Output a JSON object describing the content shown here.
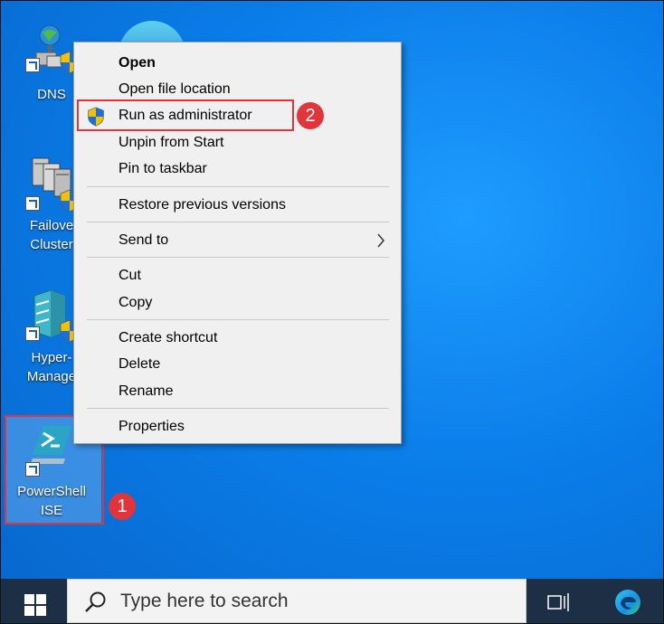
{
  "desktop": {
    "icons": [
      {
        "label": "DNS"
      },
      {
        "label": "Failove\nCluster"
      },
      {
        "label": "Hyper-\nManage"
      },
      {
        "label": "PowerShell\nISE"
      }
    ]
  },
  "context_menu": {
    "items": [
      {
        "label": "Open"
      },
      {
        "label": "Open file location"
      },
      {
        "label": "Run as administrator"
      },
      {
        "label": "Unpin from Start"
      },
      {
        "label": "Pin to taskbar"
      },
      {
        "label": "Restore previous versions"
      },
      {
        "label": "Send to"
      },
      {
        "label": "Cut"
      },
      {
        "label": "Copy"
      },
      {
        "label": "Create shortcut"
      },
      {
        "label": "Delete"
      },
      {
        "label": "Rename"
      },
      {
        "label": "Properties"
      }
    ]
  },
  "annotations": {
    "step1": "1",
    "step2": "2",
    "highlight_color": "#e0353b"
  },
  "taskbar": {
    "search_placeholder": "Type here to search",
    "start_icon": "windows-logo-icon",
    "task_view_icon": "task-view-icon",
    "edge_icon": "edge-browser-icon"
  },
  "colors": {
    "desktop": "#0a7de8",
    "taskbar": "#1c2f45",
    "menu_bg": "#f0f0f0"
  }
}
